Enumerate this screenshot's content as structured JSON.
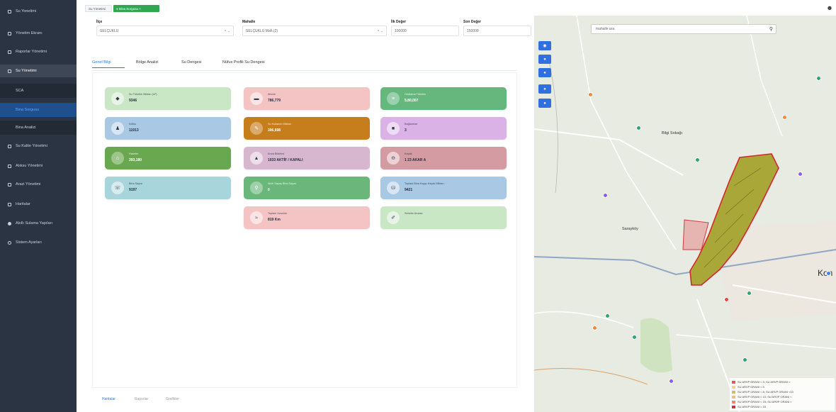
{
  "sidebar": {
    "items": [
      {
        "label": "Su Yonetimi",
        "icon": "home-icon"
      },
      {
        "label": "Yönetim Ekranı",
        "icon": "dashboard-icon"
      },
      {
        "label": "Raporlar Yönetimi",
        "icon": "report-icon"
      },
      {
        "label": "Su Yönetimi",
        "icon": "water-icon"
      },
      {
        "label": "Su Kalite Yönetimi",
        "icon": "user-icon"
      },
      {
        "label": "Atıksu Yönetimi",
        "icon": "grid-icon"
      },
      {
        "label": "Arazi Yönetimi",
        "icon": "map-icon"
      },
      {
        "label": "Haritalar",
        "icon": "layers-icon"
      },
      {
        "label": "Akıllı Sulama Yapıları",
        "icon": "dot-icon"
      },
      {
        "label": "Sistem Ayarları",
        "icon": "settings-icon"
      }
    ],
    "sub_items": [
      "SCA",
      "Bina Sorgusu",
      "Bina Analizi"
    ]
  },
  "topbar": {
    "tab1": "Su Yönetimi",
    "tab2": "● Bina Sorgusu ×"
  },
  "filters": {
    "il_label": "İlçe",
    "il_value": "SELÇUKLU",
    "mah_label": "Mahalle",
    "mah_value": "SELÇUKLU Mah.(2)",
    "bas_label": "İlk Değer",
    "bas_value": "100000",
    "son_label": "Son Değer",
    "son_value": "150000"
  },
  "tabs": [
    "Genel Bilgi",
    "Bölge Analizi",
    "Su Dengesi",
    "Nüfus Profili Su Dengesi"
  ],
  "cards": [
    {
      "label": "Su Tüketim Miktarı (m³)",
      "value": "9346",
      "icon": "drop-icon",
      "color": "#c9e6c5"
    },
    {
      "label": "Nüfus",
      "value": "11913",
      "icon": "person-icon",
      "color": "#a9c8e4"
    },
    {
      "label": "Haneler",
      "value": "393,180",
      "icon": "home-icon",
      "color": "#6aa84f"
    },
    {
      "label": "Bina Sayısı",
      "value": "9197",
      "icon": "phone-icon",
      "color": "#a8d5db"
    },
    {
      "label": "Abone",
      "value": "786,779",
      "icon": "bed-icon",
      "color": "#f4c3c4"
    },
    {
      "label": "Su Kullanım Miktarı",
      "value": "396,698",
      "icon": "tool-icon",
      "color": "#c67d1c"
    },
    {
      "label": "Arıza Bildirimi",
      "value": "1033 AKTİF / KAPALI",
      "icon": "building-icon",
      "color": "#d7b7cf"
    },
    {
      "label": "Akıllı Sayaç Bina Sayısı",
      "value": "0",
      "icon": "gauge-icon",
      "color": "#6bb77b"
    },
    {
      "label": "Toplam Uzunluk",
      "value": "819 Km",
      "icon": "pipe-icon",
      "color": "#f4c3c4"
    },
    {
      "label": "Ortalama Tüketim",
      "value": "5,80,007",
      "icon": "chart-icon",
      "color": "#65b77e"
    },
    {
      "label": "Bağlantılar",
      "value": "3",
      "icon": "link-icon",
      "color": "#dab2e6"
    },
    {
      "label": "Kaçak",
      "value": "1 23 AKAR A",
      "icon": "leak-icon",
      "color": "#d49ca2"
    },
    {
      "label": "Toplam Bina Kayıp Kaçak Miktarı",
      "value": "9421",
      "icon": "loss-icon",
      "color": "#a9c8e4"
    },
    {
      "label": "Sebeke Arızası",
      "value": "",
      "icon": "wrench-icon",
      "color": "#c9e6c5"
    }
  ],
  "bottom_tabs": [
    "Haritalar",
    "Raporlar",
    "Grafikler"
  ],
  "map": {
    "search_placeholder": "mahalle ara",
    "labels": {
      "city": "Kon",
      "district": "Sarayköy",
      "town": "Bilgi Sokağı"
    },
    "legend": [
      {
        "label": "SU ARVP ORANI < 3; SU ARVP ORANI <",
        "color": "#e15b4f"
      },
      {
        "label": "SU ARVP ORANI < 5",
        "color": "#f3cf9c"
      },
      {
        "label": "SU ARVP ORANI < 8; SU ARVP ORANI <10",
        "color": "#c8c261"
      },
      {
        "label": "SU ARVP ORANI < 10; SU ARVP ORANI <",
        "color": "#f5b98e"
      },
      {
        "label": "SU ARVP ORANI < 15; SU ARVP ORANI <",
        "color": "#e98a73"
      },
      {
        "label": "SU ARVP ORANI > 15",
        "color": "#c8353a"
      }
    ]
  }
}
